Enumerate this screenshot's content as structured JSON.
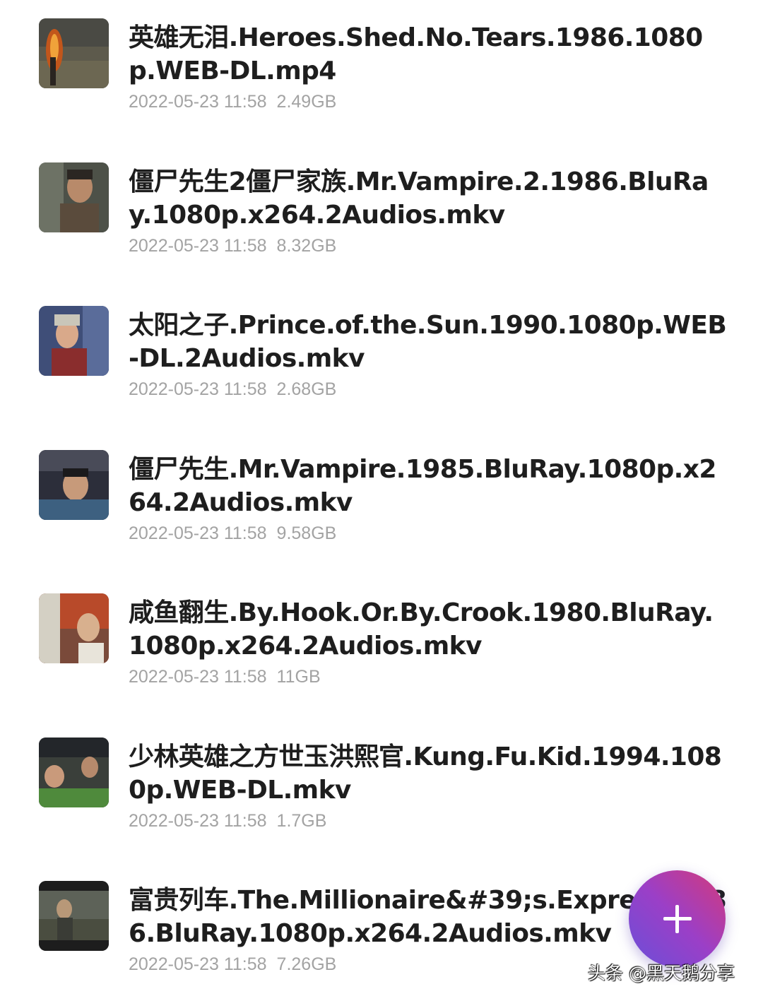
{
  "files": [
    {
      "name": "英雄无泪.Heroes.Shed.No.Tears.1986.1080p.WEB-DL.mp4",
      "date": "2022-05-23 11:58",
      "size": "2.49GB"
    },
    {
      "name": "僵尸先生2僵尸家族.Mr.Vampire.2.1986.BluRay.1080p.x264.2Audios.mkv",
      "date": "2022-05-23 11:58",
      "size": "8.32GB"
    },
    {
      "name": "太阳之子.Prince.of.the.Sun.1990.1080p.WEB-DL.2Audios.mkv",
      "date": "2022-05-23 11:58",
      "size": "2.68GB"
    },
    {
      "name": "僵尸先生.Mr.Vampire.1985.BluRay.1080p.x264.2Audios.mkv",
      "date": "2022-05-23 11:58",
      "size": "9.58GB"
    },
    {
      "name": "咸鱼翻生.By.Hook.Or.By.Crook.1980.BluRay.1080p.x264.2Audios.mkv",
      "date": "2022-05-23 11:58",
      "size": "11GB"
    },
    {
      "name": "少林英雄之方世玉洪熙官.Kung.Fu.Kid.1994.1080p.WEB-DL.mkv",
      "date": "2022-05-23 11:58",
      "size": "1.7GB"
    },
    {
      "name": "富贵列车.The.Millionaire&#39;s.Express.1986.BluRay.1080p.x264.2Audios.mkv",
      "date": "2022-05-23 11:58",
      "size": "7.26GB"
    }
  ],
  "fab": {
    "icon": "plus-icon",
    "color_start": "#6a4fd8",
    "color_end": "#d43a7a"
  },
  "watermark": {
    "text": "头条 @黑天鹅分享"
  }
}
